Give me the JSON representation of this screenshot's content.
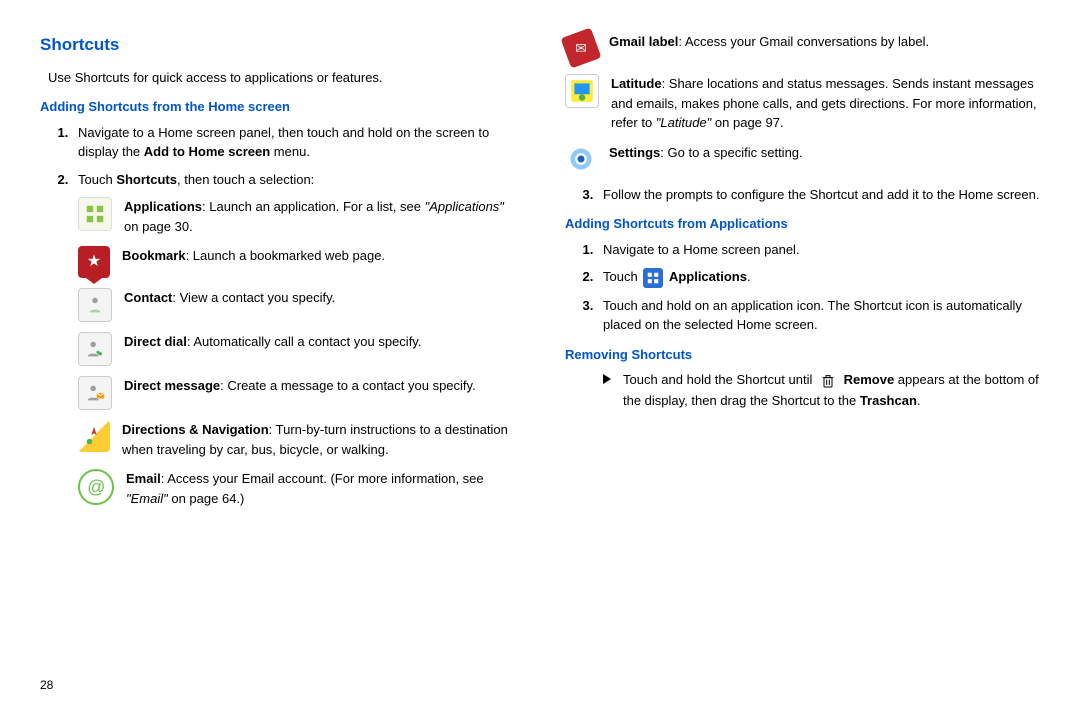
{
  "page_number": "28",
  "title": "Shortcuts",
  "intro": "Use Shortcuts for quick access to applications or features.",
  "add_home": {
    "heading": "Adding Shortcuts from the Home screen",
    "step1_a": "Navigate to a Home screen panel, then touch and hold on the screen to display the ",
    "step1_b": "Add to Home screen",
    "step1_c": " menu.",
    "step2_a": "Touch ",
    "step2_b": "Shortcuts",
    "step2_c": ", then touch a selection:",
    "icons": {
      "applications_b": "Applications",
      "applications_t1": ": Launch an application. For a list, see ",
      "applications_t2": "\"Applications\"",
      "applications_t3": " on page 30.",
      "bookmark_b": "Bookmark",
      "bookmark_t": ": Launch a bookmarked web page.",
      "contact_b": "Contact",
      "contact_t": ": View a contact you specify.",
      "dial_b": "Direct dial",
      "dial_t": ": Automatically call a contact you specify.",
      "msg_b": "Direct message",
      "msg_t": ": Create a message to a contact you specify.",
      "nav_b": "Directions & Navigation",
      "nav_t": ": Turn-by-turn instructions to a destination when traveling by car, bus, bicycle, or walking.",
      "email_b": "Email",
      "email_t1": ": Access your Email account. (For more information, see ",
      "email_t2": "\"Email\"",
      "email_t3": " on page 64.)",
      "gmail_b": "Gmail label",
      "gmail_t": ": Access your Gmail conversations by label.",
      "lat_b": "Latitude",
      "lat_t1": ": Share locations and status messages. Sends instant messages and emails, makes phone calls, and gets directions. For more information, refer to ",
      "lat_t2": "\"Latitude\"",
      "lat_t3": "  on page 97.",
      "set_b": "Settings",
      "set_t": ": Go to a specific setting."
    },
    "step3": "Follow the prompts to configure the Shortcut and add it to the Home screen."
  },
  "add_apps": {
    "heading": "Adding Shortcuts from Applications",
    "step1": "Navigate to a Home screen panel.",
    "step2_a": "Touch ",
    "step2_b": "Applications",
    "step2_c": ".",
    "step3": "Touch and hold on an application icon. The Shortcut icon is automatically placed on the selected Home screen."
  },
  "remove": {
    "heading": "Removing Shortcuts",
    "text_a": "Touch and hold the Shortcut until ",
    "text_b": "Remove",
    "text_c": " appears at the bottom of the display, then drag the Shortcut to the ",
    "text_d": "Trashcan",
    "text_e": "."
  }
}
